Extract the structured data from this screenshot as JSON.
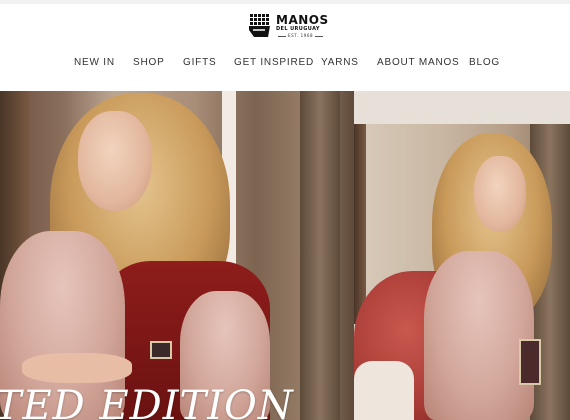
{
  "brand": {
    "name": "MANOS",
    "subtitle": "DEL URUGUAY",
    "est": "EST. 1968"
  },
  "nav": {
    "items": [
      {
        "label": "NEW IN"
      },
      {
        "label": "SHOP"
      },
      {
        "label": "GIFTS"
      },
      {
        "label": "GET INSPIRED"
      },
      {
        "label": "YARNS"
      },
      {
        "label": "ABOUT MANOS"
      },
      {
        "label": "BLOG"
      }
    ]
  },
  "hero": {
    "title": "ITED EDITION"
  },
  "colors": {
    "text": "#333333",
    "hero_title": "#ffffff",
    "background": "#ffffff"
  }
}
